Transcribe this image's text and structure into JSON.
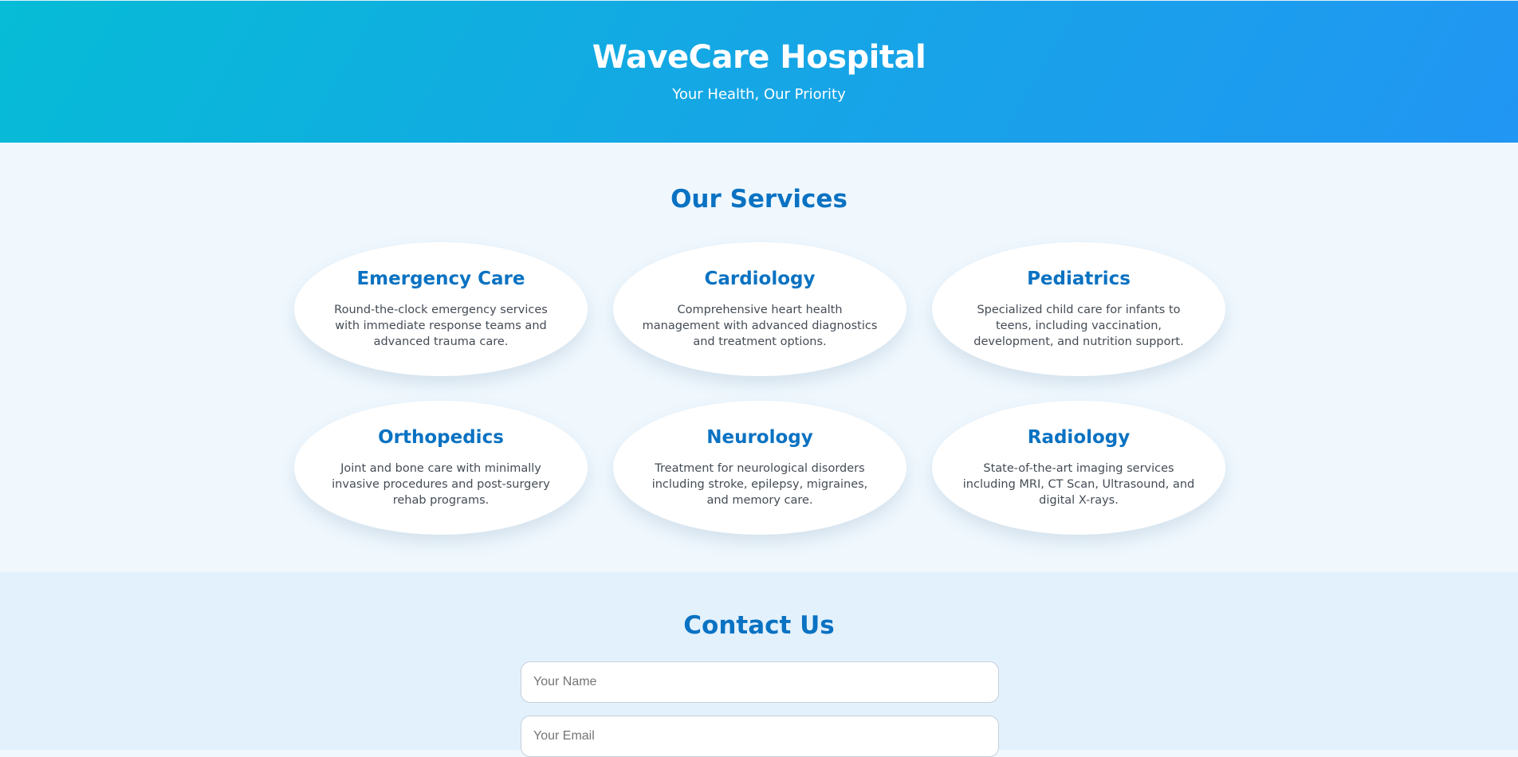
{
  "hero": {
    "title": "WaveCare Hospital",
    "subtitle": "Your Health, Our Priority"
  },
  "services": {
    "title": "Our Services",
    "items": [
      {
        "title": "Emergency Care",
        "description": "Round-the-clock emergency services with immediate response teams and advanced trauma care."
      },
      {
        "title": "Cardiology",
        "description": "Comprehensive heart health management with advanced diagnostics and treatment options."
      },
      {
        "title": "Pediatrics",
        "description": "Specialized child care for infants to teens, including vaccination, development, and nutrition support."
      },
      {
        "title": "Orthopedics",
        "description": "Joint and bone care with minimally invasive procedures and post-surgery rehab programs."
      },
      {
        "title": "Neurology",
        "description": "Treatment for neurological disorders including stroke, epilepsy, migraines, and memory care."
      },
      {
        "title": "Radiology",
        "description": "State-of-the-art imaging services including MRI, CT Scan, Ultrasound, and digital X-rays."
      }
    ]
  },
  "contact": {
    "title": "Contact Us",
    "name_placeholder": "Your Name",
    "email_placeholder": "Your Email"
  },
  "colors": {
    "brand_gradient_start": "#06bcd6",
    "brand_gradient_end": "#2196f3",
    "accent": "#0a72c2",
    "services_background": "#f0f8fe",
    "contact_background": "#e3f1fc"
  }
}
